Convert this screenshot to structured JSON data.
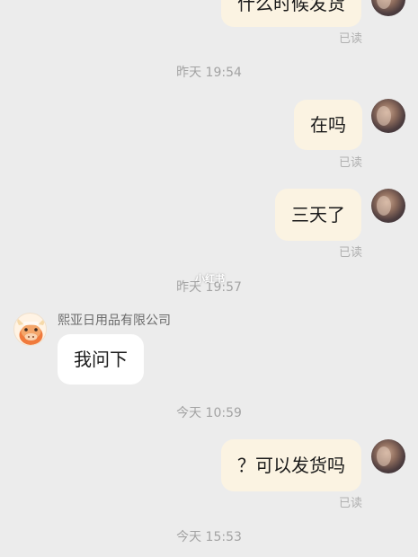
{
  "messages": {
    "m1": {
      "text": "什么时候发货",
      "status": "已读"
    },
    "t1": "昨天 19:54",
    "m2": {
      "text": "在吗",
      "status": "已读"
    },
    "m3": {
      "text": "三天了",
      "status": "已读"
    },
    "t2": "昨天 19:57",
    "m4": {
      "sender": "熙亚日用品有限公司",
      "text": "我问下"
    },
    "t3": "今天 10:59",
    "m5": {
      "text": "？可以发货吗",
      "status": "已读"
    },
    "t4": "今天 15:53"
  },
  "watermark": "小红书",
  "colors": {
    "background": "#ececec",
    "my_bubble": "#fbf3e2",
    "other_bubble": "#ffffff",
    "meta_text": "#a3a3a3"
  },
  "icons": {
    "me_avatar": "user-photo-avatar",
    "other_avatar": "merchant-cow-avatar"
  }
}
